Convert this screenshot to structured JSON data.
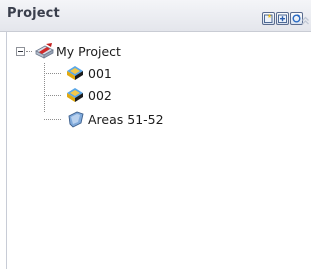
{
  "panel": {
    "title": "Project"
  },
  "toolbar": {
    "buttons": [
      {
        "name": "new-item-icon"
      },
      {
        "name": "add-item-icon"
      },
      {
        "name": "refresh-icon"
      }
    ],
    "collapse": {
      "name": "chevron-up-icon"
    }
  },
  "tree": {
    "root": {
      "label": "My Project",
      "expanded": true,
      "icon": "project-icon"
    },
    "children": [
      {
        "label": "001",
        "icon": "site-icon"
      },
      {
        "label": "002",
        "icon": "site-icon"
      },
      {
        "label": "Areas 51-52",
        "icon": "shield-icon"
      }
    ]
  }
}
